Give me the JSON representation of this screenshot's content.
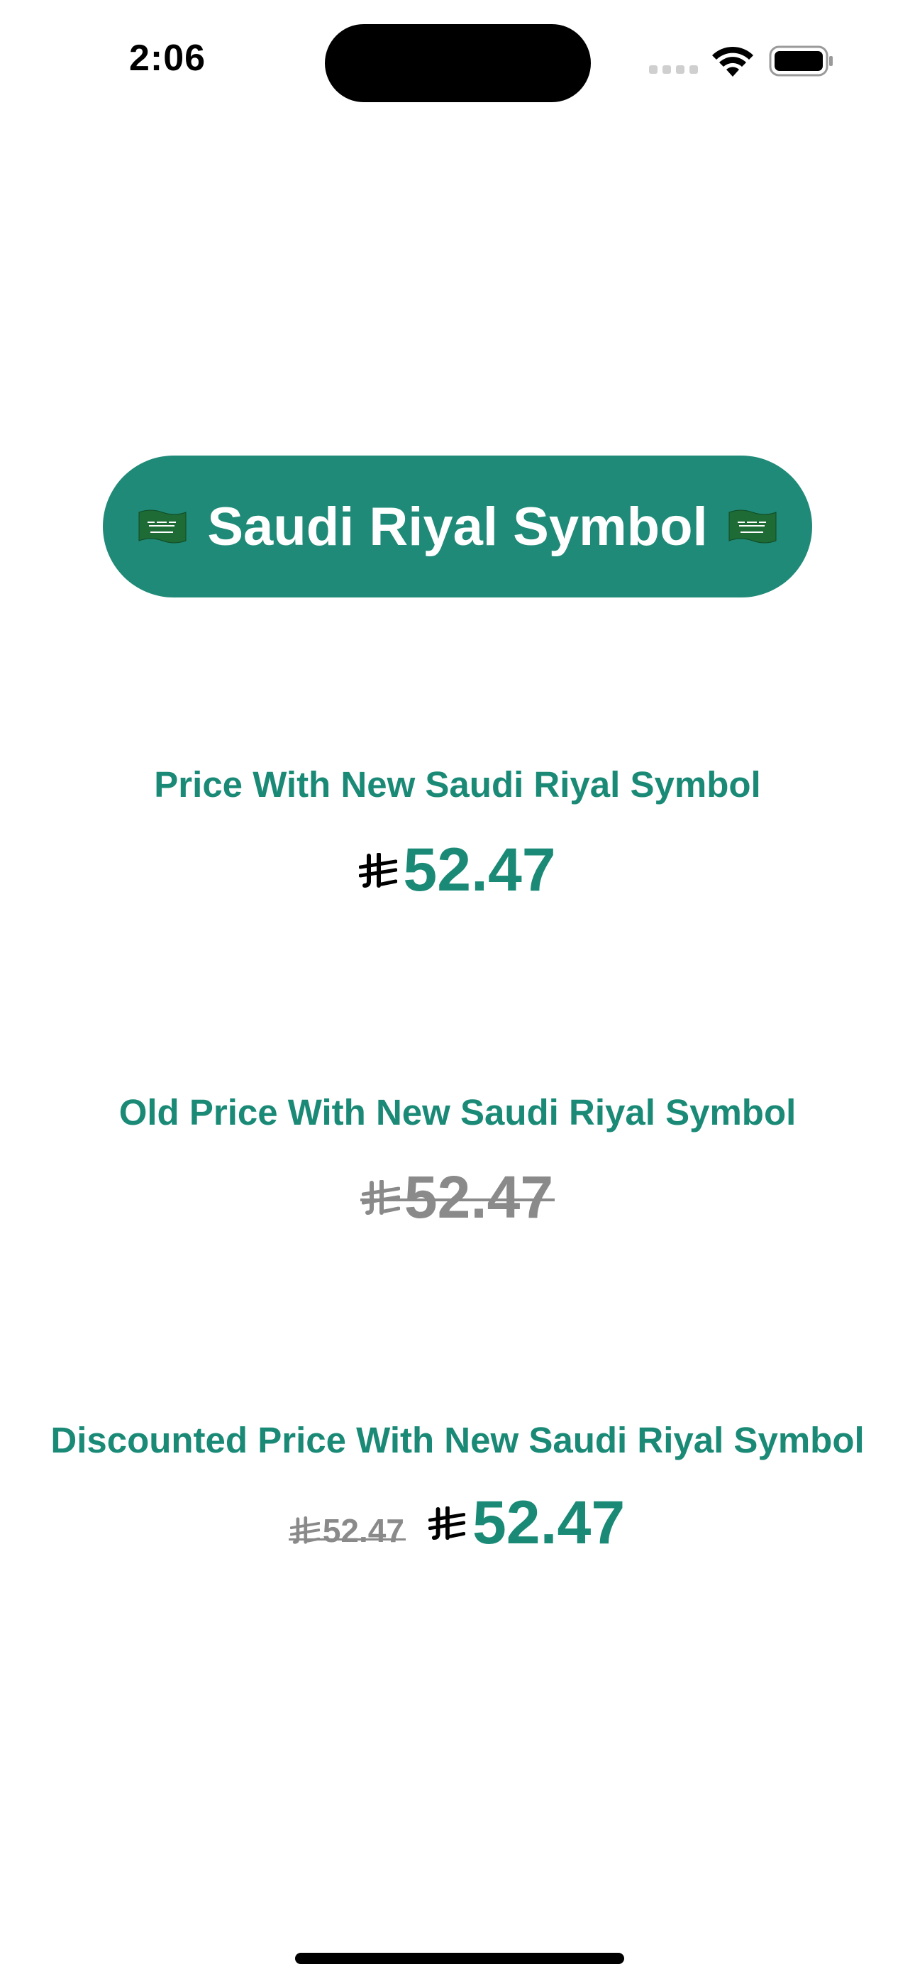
{
  "status_bar": {
    "time": "2:06"
  },
  "title_button": {
    "label": "Saudi Riyal Symbol",
    "flag_icon": "saudi-flag-icon",
    "background": "#1f8a78"
  },
  "sections": [
    {
      "label": "Price With New Saudi Riyal Symbol",
      "currency_icon": "saudi-riyal-icon",
      "price": "52.47"
    },
    {
      "label": "Old Price With New Saudi Riyal Symbol",
      "currency_icon": "saudi-riyal-icon",
      "price": "52.47",
      "strikethrough": true
    },
    {
      "label": "Discounted Price With New Saudi Riyal Symbol",
      "currency_icon": "saudi-riyal-icon",
      "old_price": "52.47",
      "new_price": "52.47"
    }
  ],
  "colors": {
    "accent": "#1a8a77",
    "muted": "#8a8a8a",
    "text_light": "#ffffff"
  }
}
